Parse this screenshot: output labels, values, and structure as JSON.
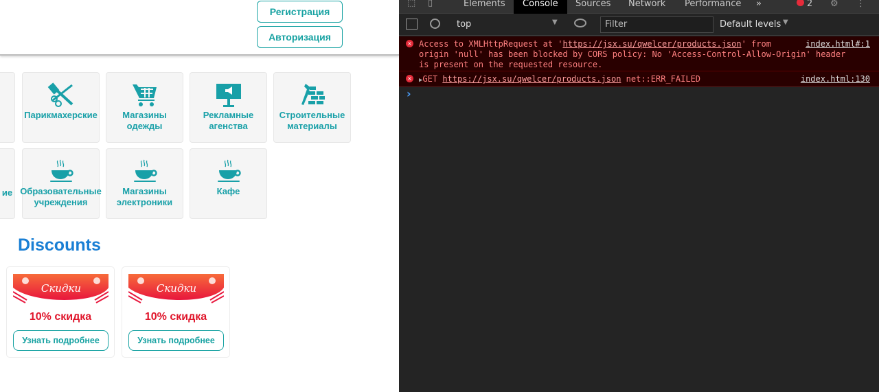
{
  "header": {
    "register": "Регистрация",
    "login": "Авторизация"
  },
  "categories": [
    {
      "label": "Парикмахерские",
      "icon": "scissors-comb-icon"
    },
    {
      "label": "Магазины\nодежды",
      "icon": "shopping-cart-icon"
    },
    {
      "label": "Рекламные\nагенства",
      "icon": "billboard-icon"
    },
    {
      "label": "Строительные\nматериалы",
      "icon": "brick-wall-icon"
    },
    {
      "label": "Образовательные\nучреждения",
      "icon": "coffee-cup-icon"
    },
    {
      "label": "Магазины\nэлектроники",
      "icon": "coffee-cup-icon"
    },
    {
      "label": "Кафе",
      "icon": "coffee-cup-icon"
    },
    {
      "label": "ие",
      "icon": ""
    }
  ],
  "discounts": {
    "title": "Discounts",
    "items": [
      {
        "banner": "Скидки",
        "title": "10% скидка",
        "button": "Узнать подробнее"
      },
      {
        "banner": "Скидки",
        "title": "10% скидка",
        "button": "Узнать подробнее"
      }
    ]
  },
  "devtools": {
    "tabs": [
      "Elements",
      "Console",
      "Sources",
      "Network",
      "Performance"
    ],
    "active_tab": "Console",
    "error_count": "2",
    "context": "top",
    "filter_placeholder": "Filter",
    "levels": "Default levels",
    "messages": [
      {
        "pre": "Access to XMLHttpRequest at '",
        "url": "https://jsx.su/qwelcer/products.json",
        "post": "' from",
        "line2": "origin 'null' has been blocked by CORS policy: No 'Access-Control-Allow-Origin' header",
        "line3": "is present on the requested resource.",
        "source": "index.html#:1"
      },
      {
        "pre": "GET ",
        "url": "https://jsx.su/qwelcer/products.json",
        "post": " net::ERR_FAILED",
        "source": "index.html:130"
      }
    ],
    "prompt": "›"
  },
  "colors": {
    "accent": "#17a2a2",
    "heading": "#1a7fd4",
    "discount": "#e0162b",
    "error_bg": "#290000"
  }
}
